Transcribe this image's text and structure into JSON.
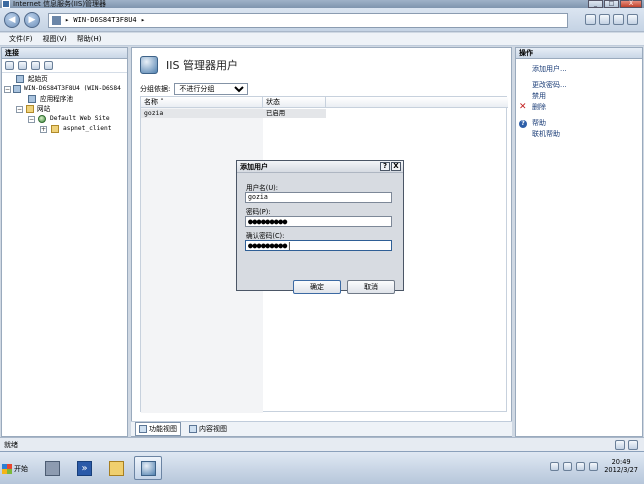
{
  "window": {
    "title": "Internet 信息服务(IIS)管理器",
    "minimize_glyph": "_",
    "maximize_glyph": "□",
    "close_glyph": "X"
  },
  "address": {
    "text": "▸ WIN-D6S84T3F8U4 ▸",
    "back_glyph": "◀",
    "forward_glyph": "▶"
  },
  "menu": [
    "文件(F)",
    "视图(V)",
    "帮助(H)"
  ],
  "connections": {
    "header": "连接",
    "tree": [
      {
        "label": "起始页",
        "level": 1,
        "icon": "start-page-icon",
        "expander": ""
      },
      {
        "label": "WIN-D6S84T3F8U4 (WIN-D6S84",
        "level": 0,
        "icon": "server-icon",
        "expander": "−"
      },
      {
        "label": "应用程序池",
        "level": 2,
        "icon": "app-pool-icon",
        "expander": ""
      },
      {
        "label": "网站",
        "level": 1,
        "icon": "sites-folder-icon",
        "expander": "−"
      },
      {
        "label": "Default Web Site",
        "level": 2,
        "icon": "globe-icon",
        "expander": "−"
      },
      {
        "label": "aspnet_client",
        "level": 3,
        "icon": "folder-icon",
        "expander": "+"
      }
    ]
  },
  "feature": {
    "title": "IIS 管理器用户",
    "groupby_label": "分组依据:",
    "groupby_value": "不进行分组",
    "columns": [
      "名称",
      "状态"
    ],
    "rows": [
      {
        "name": "gozia",
        "status": "已启用"
      }
    ]
  },
  "views": [
    {
      "label": "功能视图",
      "active": true
    },
    {
      "label": "内容视图",
      "active": false
    }
  ],
  "actions": {
    "header": "操作",
    "items": [
      {
        "label": "添加用户...",
        "icon": ""
      },
      {
        "label": "更改密码...",
        "icon": ""
      },
      {
        "label": "禁用",
        "icon": ""
      },
      {
        "label": "删除",
        "icon": "delete-icon"
      },
      {
        "label": "帮助",
        "icon": "help-icon"
      },
      {
        "label": "联机帮助",
        "icon": ""
      }
    ]
  },
  "status": {
    "text": "就绪"
  },
  "taskbar": {
    "start_label": "开始",
    "clock_time": "20:49",
    "clock_date": "2012/3/27"
  },
  "dialog": {
    "title": "添加用户",
    "help_glyph": "?",
    "close_glyph": "X",
    "username_label": "用户名(U):",
    "username_value": "gozia",
    "password_label": "密码(P):",
    "password_value": "●●●●●●●●●",
    "confirm_label": "确认密码(C):",
    "confirm_value": "●●●●●●●●●|",
    "ok_label": "确定",
    "cancel_label": "取消"
  }
}
